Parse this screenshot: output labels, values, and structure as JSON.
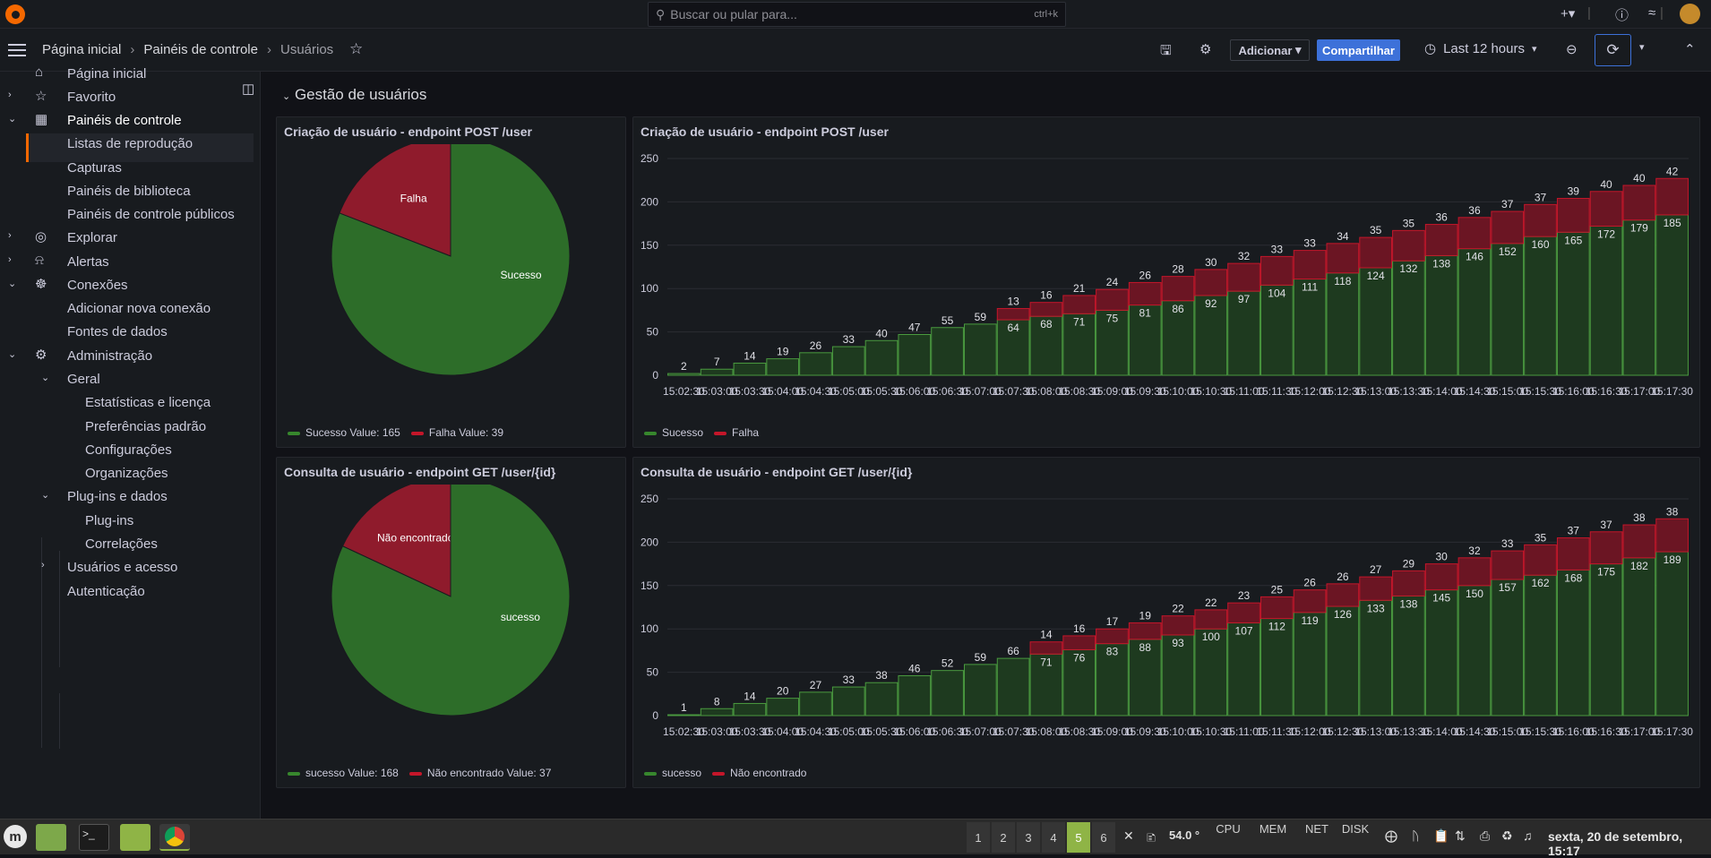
{
  "topbar": {
    "search_placeholder": "Buscar ou pular para...",
    "search_shortcut": "ctrl+k"
  },
  "navbar": {
    "breadcrumbs": [
      "Página inicial",
      "Painéis de controle",
      "Usuários"
    ],
    "add_label": "Adicionar",
    "share_label": "Compartilhar",
    "time_range": "Last 12 hours"
  },
  "sidebar": {
    "items": [
      {
        "label": "Página inicial",
        "icon": "home-icon"
      },
      {
        "label": "Favorito",
        "icon": "star-icon"
      },
      {
        "label": "Painéis de controle",
        "icon": "dashboards-icon"
      },
      {
        "label": "Listas de reprodução"
      },
      {
        "label": "Capturas"
      },
      {
        "label": "Painéis de biblioteca"
      },
      {
        "label": "Painéis de controle públicos"
      },
      {
        "label": "Explorar",
        "icon": "compass-icon"
      },
      {
        "label": "Alertas",
        "icon": "bell-icon"
      },
      {
        "label": "Conexões",
        "icon": "connections-icon"
      },
      {
        "label": "Adicionar nova conexão"
      },
      {
        "label": "Fontes de dados"
      },
      {
        "label": "Administração",
        "icon": "cog-icon"
      },
      {
        "label": "Geral"
      },
      {
        "label": "Estatísticas e licença"
      },
      {
        "label": "Preferências padrão"
      },
      {
        "label": "Configurações"
      },
      {
        "label": "Organizações"
      },
      {
        "label": "Plug-ins e dados"
      },
      {
        "label": "Plug-ins"
      },
      {
        "label": "Correlações"
      },
      {
        "label": "Usuários e acesso"
      },
      {
        "label": "Autenticação"
      }
    ]
  },
  "section": {
    "title": "Gestão de usuários"
  },
  "colors": {
    "success": "#37872d",
    "failure": "#8f1b2c",
    "accent": "#3d71d9",
    "brand": "#f46800"
  },
  "panels": {
    "pie1": {
      "title": "Criação de usuário - endpoint POST /user",
      "success_legend": "Sucesso  Value: 165",
      "failure_legend": "Falha  Value: 39"
    },
    "bar1": {
      "title": "Criação de usuário - endpoint POST /user",
      "success_legend": "Sucesso",
      "failure_legend": "Falha"
    },
    "pie2": {
      "title": "Consulta de usuário - endpoint GET /user/{id}",
      "success_legend": "sucesso  Value: 168",
      "failure_legend": "Não encontrado  Value: 37"
    },
    "bar2": {
      "title": "Consulta de usuário - endpoint GET /user/{id}",
      "success_legend": "sucesso",
      "failure_legend": "Não encontrado"
    }
  },
  "chart_data": [
    {
      "type": "pie",
      "title": "Criação de usuário - endpoint POST /user",
      "series": [
        {
          "name": "Sucesso",
          "value": 165,
          "color": "#37872d"
        },
        {
          "name": "Falha",
          "value": 39,
          "color": "#8f1b2c"
        }
      ]
    },
    {
      "type": "bar",
      "title": "Criação de usuário - endpoint POST /user",
      "stacked": true,
      "categories": [
        "15:02:30",
        "15:03:00",
        "15:03:30",
        "15:04:00",
        "15:04:30",
        "15:05:00",
        "15:05:30",
        "15:06:00",
        "15:06:30",
        "15:07:00",
        "15:07:30",
        "15:08:00",
        "15:08:30",
        "15:09:00",
        "15:09:30",
        "15:10:00",
        "15:10:30",
        "15:11:00",
        "15:11:30",
        "15:12:00",
        "15:12:30",
        "15:13:00",
        "15:13:30",
        "15:14:00",
        "15:14:30",
        "15:15:00",
        "15:15:30",
        "15:16:00",
        "15:16:30",
        "15:17:00",
        "15:17:30"
      ],
      "ylim": [
        0,
        250
      ],
      "yticks": [
        0,
        50,
        100,
        150,
        200,
        250
      ],
      "series": [
        {
          "name": "Sucesso",
          "color": "#37872d",
          "values": [
            2,
            7,
            14,
            19,
            26,
            33,
            40,
            47,
            55,
            59,
            64,
            68,
            71,
            75,
            81,
            86,
            92,
            97,
            104,
            111,
            118,
            124,
            132,
            138,
            146,
            152,
            160,
            165,
            172,
            179,
            185
          ]
        },
        {
          "name": "Falha",
          "color": "#8f1b2c",
          "values": [
            0,
            0,
            0,
            0,
            0,
            0,
            0,
            0,
            0,
            0,
            13,
            16,
            21,
            24,
            26,
            28,
            30,
            32,
            33,
            33,
            34,
            35,
            35,
            36,
            36,
            37,
            37,
            39,
            40,
            40,
            42
          ]
        }
      ]
    },
    {
      "type": "pie",
      "title": "Consulta de usuário - endpoint GET /user/{id}",
      "series": [
        {
          "name": "sucesso",
          "value": 168,
          "color": "#37872d"
        },
        {
          "name": "Não encontrado",
          "value": 37,
          "color": "#8f1b2c"
        }
      ]
    },
    {
      "type": "bar",
      "title": "Consulta de usuário - endpoint GET /user/{id}",
      "stacked": true,
      "categories": [
        "15:02:30",
        "15:03:00",
        "15:03:30",
        "15:04:00",
        "15:04:30",
        "15:05:00",
        "15:05:30",
        "15:06:00",
        "15:06:30",
        "15:07:00",
        "15:07:30",
        "15:08:00",
        "15:08:30",
        "15:09:00",
        "15:09:30",
        "15:10:00",
        "15:10:30",
        "15:11:00",
        "15:11:30",
        "15:12:00",
        "15:12:30",
        "15:13:00",
        "15:13:30",
        "15:14:00",
        "15:14:30",
        "15:15:00",
        "15:15:30",
        "15:16:00",
        "15:16:30",
        "15:17:00",
        "15:17:30"
      ],
      "ylim": [
        0,
        250
      ],
      "yticks": [
        0,
        50,
        100,
        150,
        200,
        250
      ],
      "series": [
        {
          "name": "sucesso",
          "color": "#37872d",
          "values": [
            1,
            8,
            14,
            20,
            27,
            33,
            38,
            46,
            52,
            59,
            66,
            71,
            76,
            83,
            88,
            93,
            100,
            107,
            112,
            119,
            126,
            133,
            138,
            145,
            150,
            157,
            162,
            168,
            175,
            182,
            189
          ]
        },
        {
          "name": "Não encontrado",
          "color": "#8f1b2c",
          "values": [
            0,
            0,
            0,
            0,
            0,
            0,
            0,
            0,
            0,
            0,
            0,
            14,
            16,
            17,
            19,
            22,
            22,
            23,
            25,
            26,
            26,
            27,
            29,
            30,
            32,
            33,
            35,
            37,
            37,
            38,
            38
          ]
        }
      ]
    }
  ],
  "taskbar": {
    "workspaces": [
      "1",
      "2",
      "3",
      "4",
      "5",
      "6"
    ],
    "active_workspace": "5",
    "temperature": "54.0 °",
    "monitors": [
      "CPU",
      "MEM",
      "NET",
      "DISK"
    ],
    "clock": "sexta, 20 de setembro, 15:17"
  }
}
